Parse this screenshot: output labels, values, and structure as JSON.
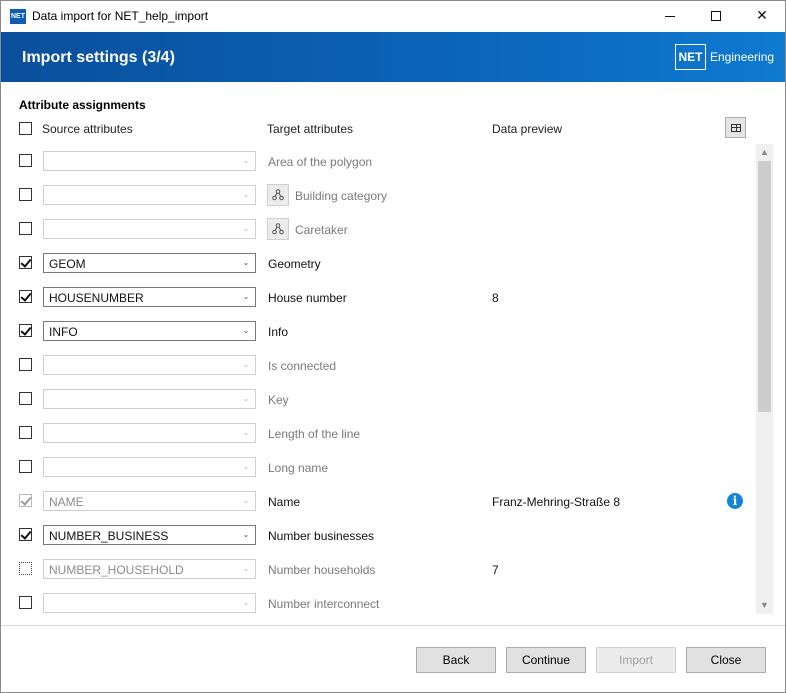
{
  "window": {
    "icon_text": "NET",
    "title": "Data import for NET_help_import"
  },
  "header": {
    "title": "Import settings (3/4)",
    "brand_box": "NET",
    "brand_text": "Engineering"
  },
  "section": {
    "title": "Attribute assignments"
  },
  "columns": {
    "source": "Source attributes",
    "target": "Target attributes",
    "preview": "Data preview"
  },
  "rows": [
    {
      "checked": false,
      "check_state": "unchecked",
      "source": "",
      "source_enabled": false,
      "target": "Area of the polygon",
      "target_dim": true,
      "relation_icon": false,
      "preview": "",
      "info": false
    },
    {
      "checked": false,
      "check_state": "unchecked",
      "source": "",
      "source_enabled": false,
      "target": "Building category",
      "target_dim": true,
      "relation_icon": true,
      "preview": "",
      "info": false
    },
    {
      "checked": false,
      "check_state": "unchecked",
      "source": "",
      "source_enabled": false,
      "target": "Caretaker",
      "target_dim": true,
      "relation_icon": true,
      "preview": "",
      "info": false
    },
    {
      "checked": true,
      "check_state": "checked",
      "source": "GEOM",
      "source_enabled": true,
      "target": "Geometry",
      "target_dim": false,
      "relation_icon": false,
      "preview": "",
      "info": false
    },
    {
      "checked": true,
      "check_state": "checked",
      "source": "HOUSENUMBER",
      "source_enabled": true,
      "target": "House number",
      "target_dim": false,
      "relation_icon": false,
      "preview": "8",
      "info": false
    },
    {
      "checked": true,
      "check_state": "checked",
      "source": "INFO",
      "source_enabled": true,
      "target": "Info",
      "target_dim": false,
      "relation_icon": false,
      "preview": "",
      "info": false
    },
    {
      "checked": false,
      "check_state": "unchecked",
      "source": "",
      "source_enabled": false,
      "target": "Is connected",
      "target_dim": true,
      "relation_icon": false,
      "preview": "",
      "info": false
    },
    {
      "checked": false,
      "check_state": "unchecked",
      "source": "",
      "source_enabled": false,
      "target": "Key",
      "target_dim": true,
      "relation_icon": false,
      "preview": "",
      "info": false
    },
    {
      "checked": false,
      "check_state": "unchecked",
      "source": "",
      "source_enabled": false,
      "target": "Length of the line",
      "target_dim": true,
      "relation_icon": false,
      "preview": "",
      "info": false
    },
    {
      "checked": false,
      "check_state": "unchecked",
      "source": "",
      "source_enabled": false,
      "target": "Long name",
      "target_dim": true,
      "relation_icon": false,
      "preview": "",
      "info": false
    },
    {
      "checked": true,
      "check_state": "checked-disabled",
      "source": "NAME",
      "source_enabled": false,
      "target": "Name",
      "target_dim": false,
      "relation_icon": false,
      "preview": "Franz-Mehring-Straße 8",
      "info": true
    },
    {
      "checked": true,
      "check_state": "checked",
      "source": "NUMBER_BUSINESS",
      "source_enabled": true,
      "target": "Number businesses",
      "target_dim": false,
      "relation_icon": false,
      "preview": "",
      "info": false
    },
    {
      "checked": false,
      "check_state": "indeterminate",
      "source": "NUMBER_HOUSEHOLD",
      "source_enabled": false,
      "target": "Number households",
      "target_dim": true,
      "relation_icon": false,
      "preview": "7",
      "info": false
    },
    {
      "checked": false,
      "check_state": "unchecked",
      "source": "",
      "source_enabled": false,
      "target": "Number interconnect",
      "target_dim": true,
      "relation_icon": false,
      "preview": "",
      "info": false
    }
  ],
  "icons": {
    "info": "i",
    "dropdown": "⌄",
    "scroll_up": "▲",
    "scroll_down": "▼"
  },
  "buttons": {
    "back": "Back",
    "continue": "Continue",
    "import": "Import",
    "close": "Close"
  },
  "colors": {
    "header_start": "#0a4f9c",
    "header_end": "#0e7ad0",
    "info": "#1486d6"
  }
}
